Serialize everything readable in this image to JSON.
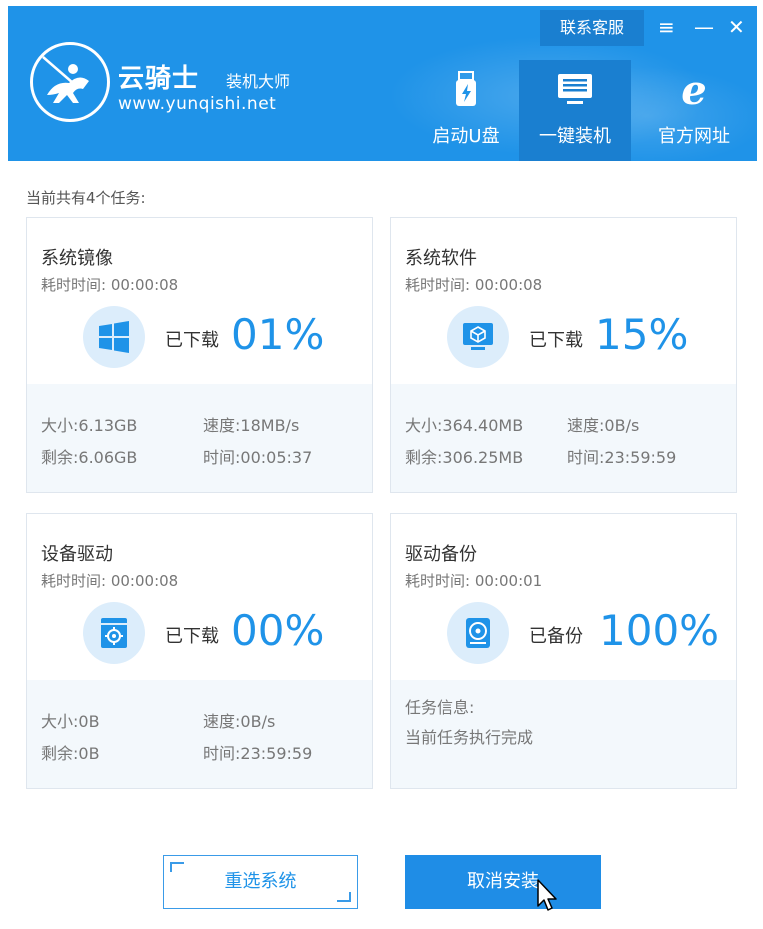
{
  "header": {
    "brand_name": "云骑士",
    "brand_sub": "装机大师",
    "brand_url": "www.yunqishi.net",
    "support_label": "联系客服",
    "menu_icon": "≡",
    "min_icon": "—",
    "close_icon": "✕",
    "nav": [
      {
        "label": "启动U盘",
        "icon": "usb-icon"
      },
      {
        "label": "一键装机",
        "icon": "monitor-icon",
        "active": true
      },
      {
        "label": "官方网址",
        "icon": "ie-icon"
      }
    ]
  },
  "task_count_label": "当前共有4个任务:",
  "tasks": [
    {
      "title": "系统镜像",
      "elapsed_label": "耗时时间:",
      "elapsed": "00:00:08",
      "icon": "windows-icon",
      "status": "已下载",
      "percent": "01%",
      "size_label": "大小:",
      "size": "6.13GB",
      "speed_label": "速度:",
      "speed": "18MB/s",
      "remain_label": "剩余:",
      "remain": "6.06GB",
      "time_label": "时间:",
      "time": "00:05:37"
    },
    {
      "title": "系统软件",
      "elapsed_label": "耗时时间:",
      "elapsed": "00:00:08",
      "icon": "software-box-icon",
      "status": "已下载",
      "percent": "15%",
      "size_label": "大小:",
      "size": "364.40MB",
      "speed_label": "速度:",
      "speed": "0B/s",
      "remain_label": "剩余:",
      "remain": "306.25MB",
      "time_label": "时间:",
      "time": "23:59:59"
    },
    {
      "title": "设备驱动",
      "elapsed_label": "耗时时间:",
      "elapsed": "00:00:08",
      "icon": "driver-gear-icon",
      "status": "已下载",
      "percent": "00%",
      "size_label": "大小:",
      "size": "0B",
      "speed_label": "速度:",
      "speed": "0B/s",
      "remain_label": "剩余:",
      "remain": "0B",
      "time_label": "时间:",
      "time": "23:59:59"
    },
    {
      "title": "驱动备份",
      "elapsed_label": "耗时时间:",
      "elapsed": "00:00:01",
      "icon": "harddisk-icon",
      "status": "已备份",
      "percent": "100%",
      "info_label": "任务信息:",
      "info_text": "当前任务执行完成"
    }
  ],
  "buttons": {
    "reselect": "重选系统",
    "cancel": "取消安装"
  }
}
